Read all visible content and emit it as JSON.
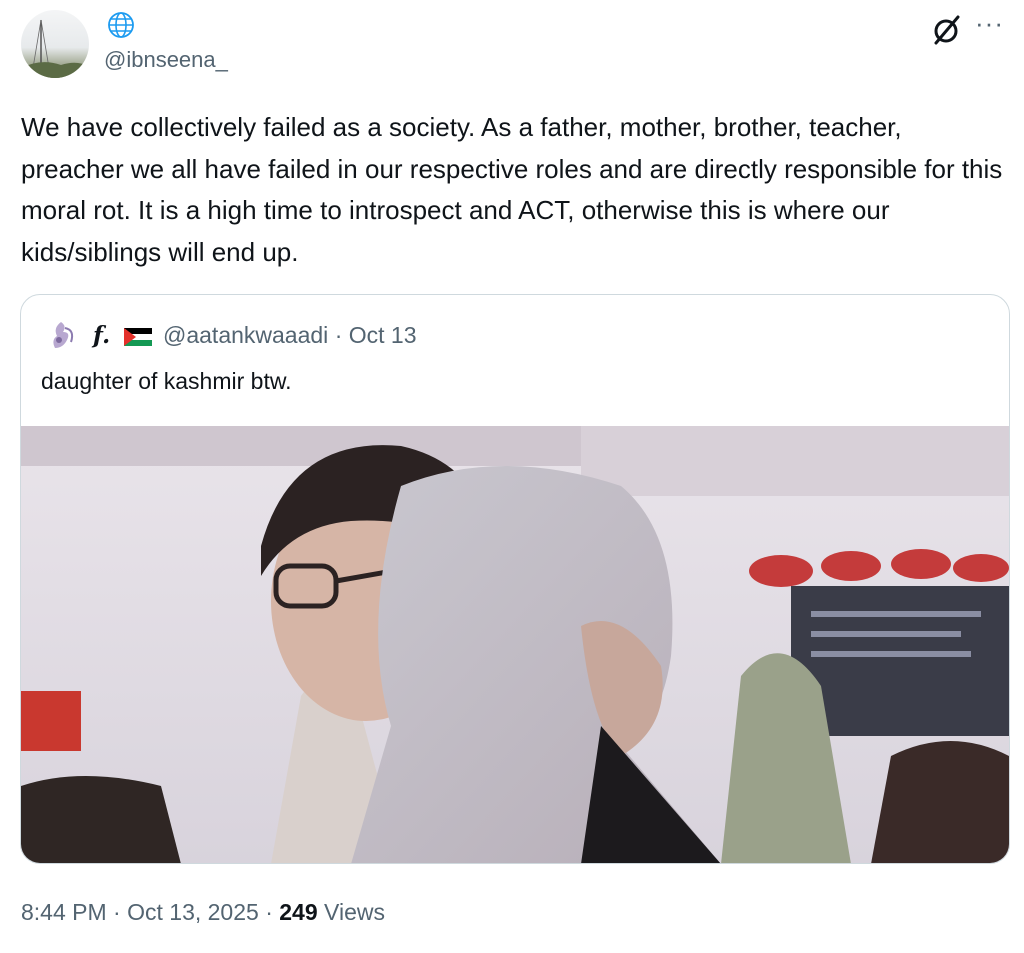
{
  "author": {
    "handle": "@ibnseena_",
    "avatar_icon": "radio-tower-avatar",
    "badge_icon": "globe-icon"
  },
  "actions": {
    "grok_icon": "grok-icon",
    "more_label": "···"
  },
  "tweet": {
    "text": "We have collectively failed as a society. As a father, mother, brother, teacher, preacher we all have failed in our respective roles and are directly responsible for this moral rot. It is a high time to introspect and ACT, otherwise this is where our kids/siblings will end up."
  },
  "quoted": {
    "name": "f.",
    "flag_icon": "palestine-flag-icon",
    "handle": "@aatankwaaadi",
    "date": "Oct 13",
    "text": "daughter of kashmir btw."
  },
  "meta": {
    "time": "8:44 PM",
    "date": "Oct 13, 2025",
    "views_count": "249",
    "views_label": "Views"
  }
}
